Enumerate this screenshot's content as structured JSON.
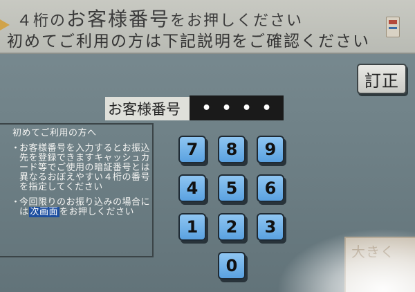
{
  "header": {
    "line1_part1": "４桁の",
    "line1_part2": "お客様番号",
    "line1_part3": "をお押しください",
    "line2": "初めてご利用の方は下記説明をご確認ください"
  },
  "correct_button": {
    "label": "訂正"
  },
  "customer_number": {
    "label": "お客様番号",
    "masked_digits": [
      "•",
      "•",
      "•",
      "•"
    ]
  },
  "info": {
    "title": "初めてご利用の方へ",
    "item1": "お客様番号を入力するとお振込先を登録できますキャッシュカード等でご使用の暗証番号とは異なるおぼえやすい４桁の番号を指定してください",
    "item2_before": "今回限りのお振り込みの場合には",
    "item2_highlight": "次画面",
    "item2_after": "をお押しください"
  },
  "keypad": {
    "k7": "7",
    "k8": "8",
    "k9": "9",
    "k4": "4",
    "k5": "5",
    "k6": "6",
    "k1": "1",
    "k2": "2",
    "k3": "3",
    "k0": "0"
  },
  "corner_sign": {
    "text": "大きく"
  },
  "colors": {
    "key_blue": "#6eb0ea",
    "highlight_blue": "#1d4fa0",
    "header_bg": "#c8c9c2"
  }
}
